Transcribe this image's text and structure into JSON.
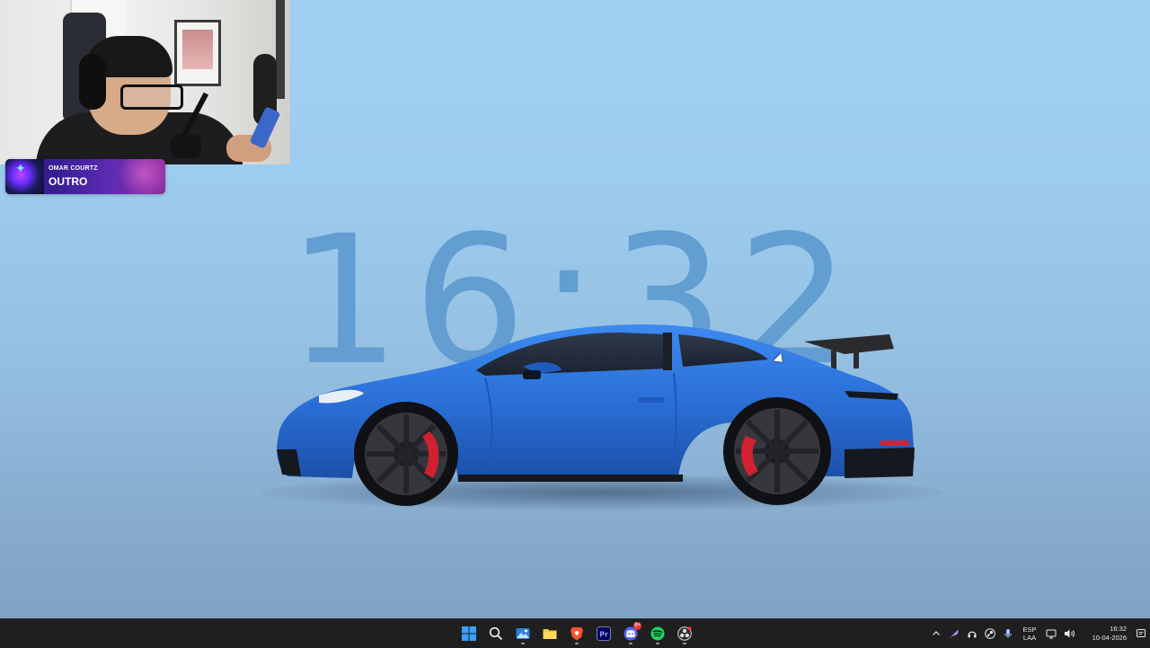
{
  "overlay": {
    "now_playing": {
      "artist": "OMAR COURTZ",
      "track": "OUTRO"
    }
  },
  "wallpaper": {
    "clock_text": "16:32"
  },
  "taskbar": {
    "apps": [
      {
        "name": "start-button",
        "icon": "windows-logo-icon"
      },
      {
        "name": "search-button",
        "icon": "search-icon"
      },
      {
        "name": "photos-app",
        "icon": "photos-icon"
      },
      {
        "name": "file-explorer-app",
        "icon": "folder-icon"
      },
      {
        "name": "brave-browser-app",
        "icon": "brave-lion-icon"
      },
      {
        "name": "premiere-pro-app",
        "icon": "premiere-icon",
        "label": "Pr"
      },
      {
        "name": "discord-app",
        "icon": "discord-icon",
        "badge": "9+"
      },
      {
        "name": "spotify-app",
        "icon": "spotify-icon"
      },
      {
        "name": "obs-app",
        "icon": "obs-icon"
      }
    ],
    "tray": {
      "language_line1": "ESP",
      "language_line2": "LAA",
      "time": "16:32",
      "date": "10-04-2026"
    }
  },
  "colors": {
    "taskbar_bg": "#1f1f1f",
    "car_blue": "#2a6fd6",
    "clock_blue": "#5f9bd0"
  }
}
